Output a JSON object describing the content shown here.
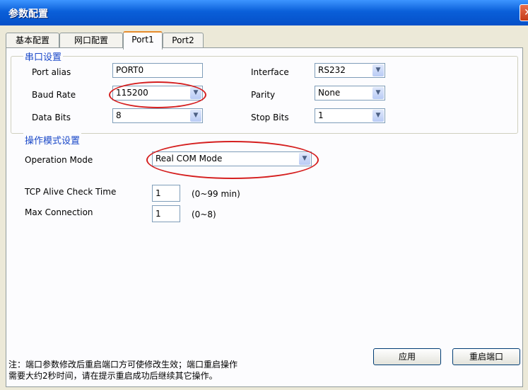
{
  "window": {
    "title": "参数配置",
    "close_glyph": "✕"
  },
  "tabs": [
    {
      "label": "基本配置"
    },
    {
      "label": "网口配置"
    },
    {
      "label": "Port1"
    },
    {
      "label": "Port2"
    }
  ],
  "serial": {
    "group_label": "串口设置",
    "port_alias": {
      "label": "Port alias",
      "value": "PORT0"
    },
    "baud_rate": {
      "label": "Baud Rate",
      "value": "115200"
    },
    "data_bits": {
      "label": "Data Bits",
      "value": "8"
    },
    "interface": {
      "label": "Interface",
      "value": "RS232"
    },
    "parity": {
      "label": "Parity",
      "value": "None"
    },
    "stop_bits": {
      "label": "Stop Bits",
      "value": "1"
    }
  },
  "mode": {
    "group_label": "操作模式设置",
    "operation_mode": {
      "label": "Operation Mode",
      "value": "Real COM Mode"
    },
    "tcp_alive": {
      "label": "TCP Alive Check Time",
      "value": "1",
      "hint": "(0~99 min)"
    },
    "max_connection": {
      "label": "Max Connection",
      "value": "1",
      "hint": "(0~8)"
    }
  },
  "footer": {
    "note_line1": "注：端口参数修改后重启端口方可使修改生效；端口重启操作",
    "note_line2": "需要大约2秒时间，请在提示重启成功后继续其它操作。",
    "apply_label": "应用",
    "restart_label": "重启端口"
  },
  "icons": {
    "dropdown": "chevron-down-icon",
    "close": "close-icon"
  },
  "colors": {
    "titlebar": "#0a5fd9",
    "group_label": "#1a48c8",
    "highlight_ellipse": "#d51f1f",
    "active_tab": "#e68b2c"
  }
}
